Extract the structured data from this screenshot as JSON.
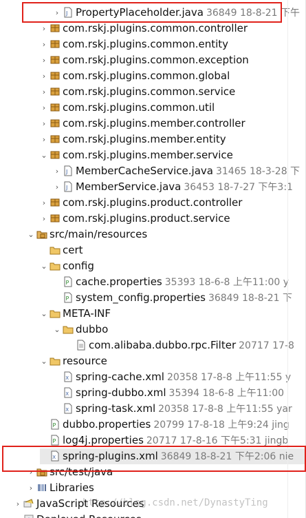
{
  "tree": {
    "rows": [
      {
        "label": "PropertyPlaceholder.java",
        "meta": "36849  18-8-21 下午",
        "icon": "java-file-icon",
        "twisty": "closed",
        "indent": 1
      },
      {
        "label": "com.rskj.plugins.common.controller",
        "meta": "",
        "icon": "package-icon",
        "twisty": "closed",
        "indent": 0
      },
      {
        "label": "com.rskj.plugins.common.entity",
        "meta": "",
        "icon": "package-icon",
        "twisty": "closed",
        "indent": 0
      },
      {
        "label": "com.rskj.plugins.common.exception",
        "meta": "",
        "icon": "package-icon",
        "twisty": "closed",
        "indent": 0
      },
      {
        "label": "com.rskj.plugins.common.global",
        "meta": "",
        "icon": "package-icon",
        "twisty": "closed",
        "indent": 0
      },
      {
        "label": "com.rskj.plugins.common.service",
        "meta": "",
        "icon": "package-icon",
        "twisty": "closed",
        "indent": 0
      },
      {
        "label": "com.rskj.plugins.common.util",
        "meta": "",
        "icon": "package-icon",
        "twisty": "closed",
        "indent": 0
      },
      {
        "label": "com.rskj.plugins.member.controller",
        "meta": "",
        "icon": "package-icon",
        "twisty": "closed",
        "indent": 0
      },
      {
        "label": "com.rskj.plugins.member.entity",
        "meta": "",
        "icon": "package-icon",
        "twisty": "closed",
        "indent": 0
      },
      {
        "label": "com.rskj.plugins.member.service",
        "meta": "",
        "icon": "package-icon",
        "twisty": "open",
        "indent": 0
      },
      {
        "label": "MemberCacheService.java",
        "meta": "31465  18-3-28 下",
        "icon": "java-file-icon",
        "twisty": "closed",
        "indent": 1
      },
      {
        "label": "MemberService.java",
        "meta": "36453  18-7-27 下午3:1",
        "icon": "java-file-icon",
        "twisty": "closed",
        "indent": 1
      },
      {
        "label": "com.rskj.plugins.product.controller",
        "meta": "",
        "icon": "package-icon",
        "twisty": "closed",
        "indent": 0
      },
      {
        "label": "com.rskj.plugins.product.service",
        "meta": "",
        "icon": "package-icon",
        "twisty": "closed",
        "indent": 0
      },
      {
        "label": "src/main/resources",
        "meta": "",
        "icon": "source-folder-icon",
        "twisty": "open",
        "indent": -1
      },
      {
        "label": "cert",
        "meta": "",
        "icon": "folder-icon",
        "twisty": "none",
        "indent": 0
      },
      {
        "label": "config",
        "meta": "",
        "icon": "folder-icon",
        "twisty": "open",
        "indent": 0
      },
      {
        "label": "cache.properties",
        "meta": "35393  18-6-8 上午11:00  y",
        "icon": "properties-file-icon",
        "twisty": "none",
        "indent": 1
      },
      {
        "label": "system_config.properties",
        "meta": "36849  18-8-21 下",
        "icon": "properties-file-icon",
        "twisty": "none",
        "indent": 1
      },
      {
        "label": "META-INF",
        "meta": "",
        "icon": "folder-icon",
        "twisty": "open",
        "indent": 0
      },
      {
        "label": "dubbo",
        "meta": "",
        "icon": "folder-icon",
        "twisty": "open",
        "indent": 1
      },
      {
        "label": "com.alibaba.dubbo.rpc.Filter",
        "meta": "20717  17-8",
        "icon": "text-file-icon",
        "twisty": "none",
        "indent": 2
      },
      {
        "label": "resource",
        "meta": "",
        "icon": "folder-icon",
        "twisty": "open",
        "indent": 0
      },
      {
        "label": "spring-cache.xml",
        "meta": "20358  17-8-8 上午11:55  y",
        "icon": "xml-file-icon",
        "twisty": "none",
        "indent": 1
      },
      {
        "label": "spring-dubbo.xml",
        "meta": "35394  18-6-8 上午11:00",
        "icon": "xml-file-icon",
        "twisty": "none",
        "indent": 1
      },
      {
        "label": "spring-task.xml",
        "meta": "20358  17-8-8 上午11:55  yar",
        "icon": "xml-file-icon",
        "twisty": "none",
        "indent": 1
      },
      {
        "label": "dubbo.properties",
        "meta": "20799  17-8-18 上午9:24  jing",
        "icon": "properties-file-icon",
        "twisty": "none",
        "indent": 0
      },
      {
        "label": "log4j.properties",
        "meta": "20717  17-8-16 下午5:31  jingb",
        "icon": "properties-file-icon",
        "twisty": "none",
        "indent": 0
      },
      {
        "label": "spring-plugins.xml",
        "meta": "36849  18-8-21 下午2:06  nie",
        "icon": "xml-file-icon",
        "twisty": "none",
        "indent": 0
      },
      {
        "label": "src/test/java",
        "meta": "",
        "icon": "source-folder-icon",
        "twisty": "closed",
        "indent": -1
      },
      {
        "label": "Libraries",
        "meta": "",
        "icon": "library-icon",
        "twisty": "closed",
        "indent": -1
      },
      {
        "label": "JavaScript Resources",
        "meta": "",
        "icon": "js-resources-icon",
        "twisty": "closed",
        "indent": -2
      },
      {
        "label": "Deployed Resources",
        "meta": "",
        "icon": "deployed-resources-icon",
        "twisty": "closed",
        "indent": -2
      }
    ],
    "selected_label": "spring-plugins.xml"
  },
  "watermark": "http://blog.csdn.net/DynastyTing",
  "colors": {
    "highlight": "#e0211a",
    "selection": "#e9e9e9"
  }
}
